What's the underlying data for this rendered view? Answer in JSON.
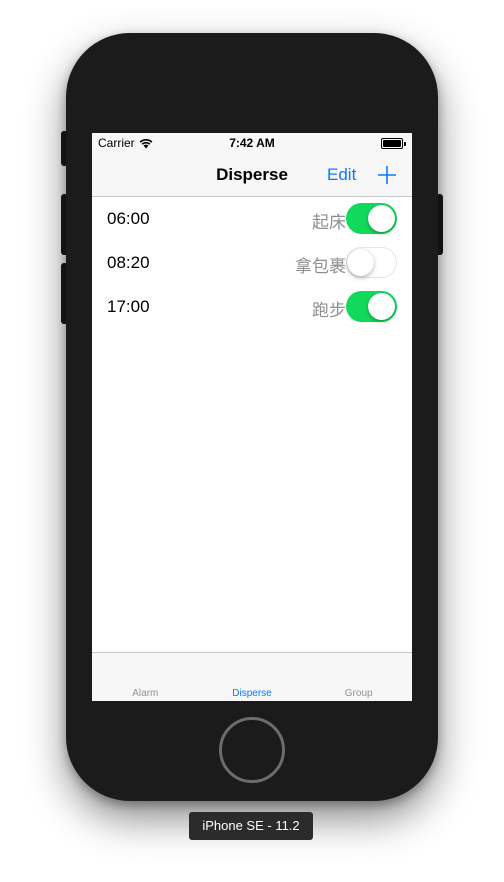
{
  "status_bar": {
    "carrier": "Carrier",
    "time": "7:42 AM",
    "wifi_icon": "wifi-icon",
    "battery_icon": "battery-icon",
    "battery_level": 1.0
  },
  "nav_bar": {
    "title": "Disperse",
    "edit_label": "Edit",
    "add_icon": "plus-icon"
  },
  "alarms": [
    {
      "time": "06:00",
      "label": "起床",
      "enabled": true
    },
    {
      "time": "08:20",
      "label": "拿包裹",
      "enabled": false
    },
    {
      "time": "17:00",
      "label": "跑步",
      "enabled": true
    }
  ],
  "tab_bar": {
    "tabs": [
      {
        "label": "Alarm",
        "active": false
      },
      {
        "label": "Disperse",
        "active": true
      },
      {
        "label": "Group",
        "active": false
      }
    ]
  },
  "device_caption": "iPhone SE - 11.2",
  "colors": {
    "accent": "#0a7aff",
    "switch_on": "#11d95c",
    "device_body": "#1b1b1b"
  }
}
